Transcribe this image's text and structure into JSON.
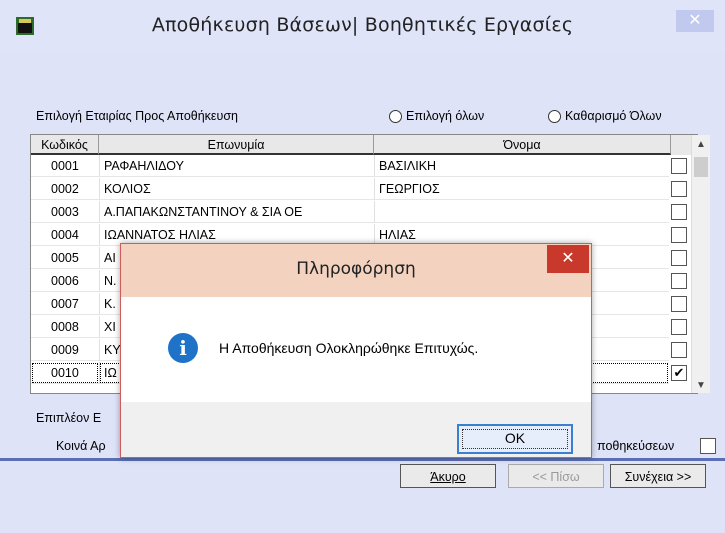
{
  "window": {
    "title": "Αποθήκευση Βάσεων| Βοηθητικές Εργασίες",
    "close_glyph": "✕"
  },
  "selection": {
    "label": "Επιλογή Εταιρίας Προς Αποθήκευση",
    "select_all": "Επιλογή όλων",
    "clear_all": "Καθαρισμό Όλων"
  },
  "grid": {
    "columns": [
      "Κωδικός",
      "Επωνυμία",
      "Όνομα"
    ],
    "rows": [
      {
        "code": "0001",
        "name": "ΡΑΦΑΗΛΙΔΟΥ",
        "first": "ΒΑΣΙΛΙΚΗ",
        "checked": false
      },
      {
        "code": "0002",
        "name": "ΚΟΛΙΟΣ",
        "first": "ΓΕΩΡΓΙΟΣ",
        "checked": false
      },
      {
        "code": "0003",
        "name": "Α.ΠΑΠΑΚΩΝΣΤΑΝΤΙΝΟΥ & ΣΙΑ ΟΕ",
        "first": "",
        "checked": false
      },
      {
        "code": "0004",
        "name": "ΙΩΑΝΝΑΤΟΣ ΗΛΙΑΣ",
        "first": "ΗΛΙΑΣ",
        "checked": false
      },
      {
        "code": "0005",
        "name": "ΑΙ",
        "first": "",
        "checked": false
      },
      {
        "code": "0006",
        "name": "Ν.",
        "first": "",
        "checked": false
      },
      {
        "code": "0007",
        "name": "Κ.",
        "first": "",
        "checked": false
      },
      {
        "code": "0008",
        "name": "ΧΙ",
        "first": "",
        "checked": false
      },
      {
        "code": "0009",
        "name": "ΚΥ",
        "first": "",
        "checked": false
      },
      {
        "code": "0010",
        "name": "ΙΩ",
        "first": "",
        "checked": true
      }
    ],
    "scroll_up": "▲",
    "scroll_down": "▼"
  },
  "footer": {
    "more_label": "Επιπλέον Ε",
    "common_label": "Κοινά Αρ",
    "storage_label": "ποθηκεύσεων",
    "cancel": "Άκυρο",
    "back": "<< Πίσω",
    "next": "Συνέχεια >>"
  },
  "modal": {
    "title": "Πληροφόρηση",
    "close_glyph": "✕",
    "info_glyph": "i",
    "message": "Η Αποθήκευση Ολοκληρώθηκε Επιτυχώς.",
    "ok": "OK"
  },
  "colors": {
    "title_bar": "#dfe4f9",
    "modal_title_bar": "#f3d2c0",
    "modal_close": "#c8392b",
    "info_icon": "#1e73c9",
    "separator": "#5a6fb5"
  }
}
